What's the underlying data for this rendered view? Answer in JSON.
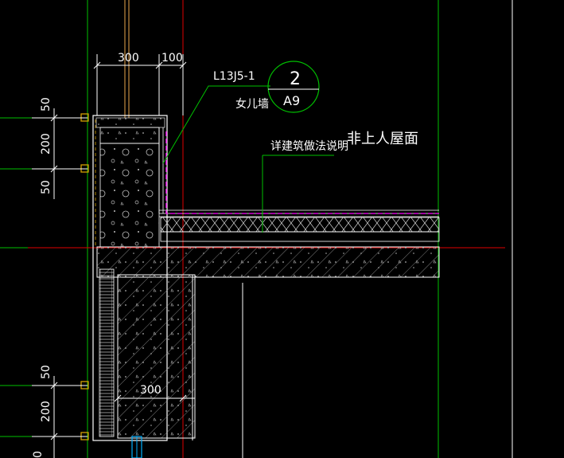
{
  "drawing": {
    "dimensions": {
      "top_left": "300",
      "top_right": "100",
      "left_upper_1": "50",
      "left_upper_2": "200",
      "left_upper_3": "50",
      "left_lower_1": "50",
      "left_lower_2": "200",
      "left_lower_3": "0",
      "beam_width": "300"
    },
    "labels": {
      "atlas_ref": "L13J5-1",
      "parapet": "女儿墙",
      "roof_type": "非上人屋面",
      "see_notes": "详建筑做法说明"
    },
    "detail_bubble": {
      "number": "2",
      "sheet": "A9"
    },
    "colors": {
      "background": "#000000",
      "axis_red": "#e00000",
      "guide_green": "#00c000",
      "outline_white": "#ffffff",
      "membrane_magenta": "#ff00ff",
      "anchor_yellow": "#d4a000",
      "dim_text": "#ffffff"
    }
  }
}
